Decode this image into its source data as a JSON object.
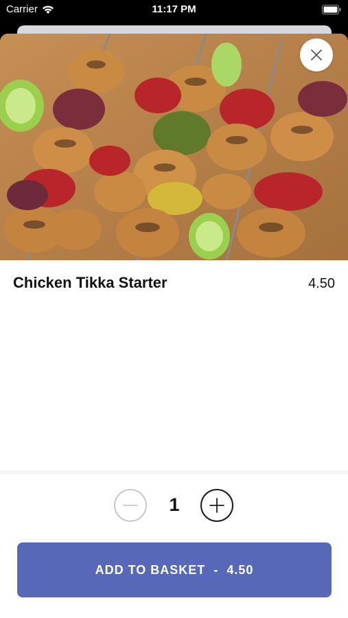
{
  "status_bar": {
    "carrier": "Carrier",
    "time": "11:17 PM",
    "icons": [
      "wifi-icon",
      "battery-icon"
    ]
  },
  "hero_image": {
    "description_icon": "food-photo",
    "close_icon": "close-icon"
  },
  "item": {
    "name": "Chicken Tikka Starter",
    "price": "4.50"
  },
  "quantity": {
    "value": "1",
    "minus_icon": "minus-icon",
    "plus_icon": "plus-icon"
  },
  "add_to_basket": {
    "label": "ADD TO BASKET",
    "separator": "-",
    "price": "4.50"
  },
  "colors": {
    "primary_button": "#5868b8",
    "background": "#ffffff"
  }
}
